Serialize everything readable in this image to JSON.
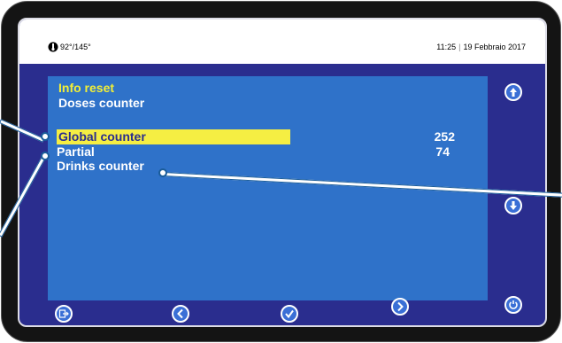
{
  "status": {
    "temperature": "92°/145°",
    "time": "11:25",
    "date": "19 Febbraio 2017"
  },
  "screen": {
    "title": "Info reset",
    "subtitle": "Doses counter",
    "rows": [
      {
        "label": "Global counter",
        "value": "252",
        "selected": true
      },
      {
        "label": "Partial",
        "value": "74",
        "selected": false
      },
      {
        "label": "Drinks counter",
        "value": "",
        "selected": false
      }
    ]
  },
  "buttons": {
    "up": "arrow-up-icon",
    "down": "arrow-down-icon",
    "back": "exit-icon",
    "prev": "chevron-left-icon",
    "ok": "check-icon",
    "next": "chevron-right-icon",
    "power": "power-icon"
  },
  "colors": {
    "screen_bg": "#2a2d8e",
    "panel_bg": "#2f72c9",
    "selection": "#f5ee43",
    "title": "#f2ef36"
  }
}
